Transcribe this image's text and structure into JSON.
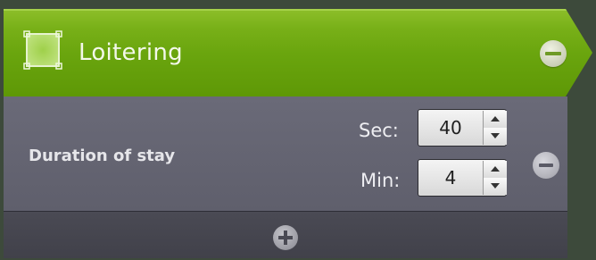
{
  "rule": {
    "title": "Loitering",
    "header_icon": "loitering-zone-icon",
    "remove_icon": "minus-circle-icon"
  },
  "condition": {
    "label": "Duration of stay",
    "sec_label": "Sec:",
    "sec_value": "40",
    "min_label": "Min:",
    "min_value": "4",
    "remove_icon": "minus-circle-icon"
  },
  "footer": {
    "add_icon": "plus-circle-icon"
  },
  "colors": {
    "header_green": "#6aa50e",
    "body_gray": "#65656f",
    "footer_dark": "#45454e"
  }
}
